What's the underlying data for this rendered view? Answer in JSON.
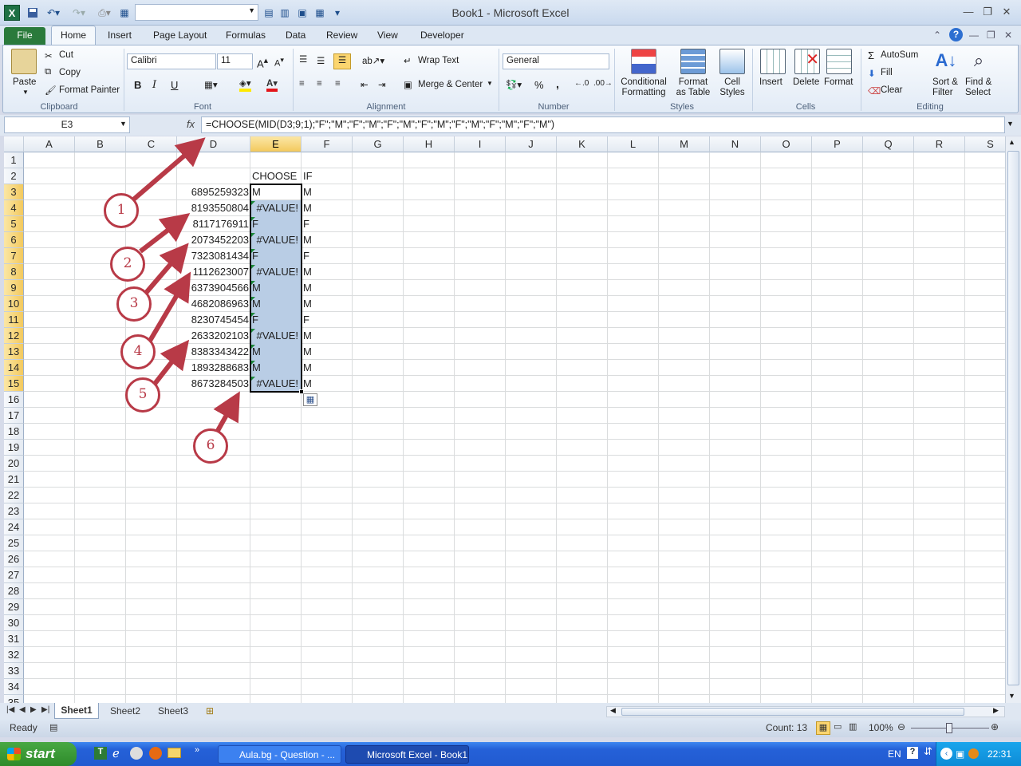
{
  "window": {
    "title": "Book1  -  Microsoft Excel"
  },
  "ribbon_tabs": [
    "File",
    "Home",
    "Insert",
    "Page Layout",
    "Formulas",
    "Data",
    "Review",
    "View",
    "Developer"
  ],
  "clipboard": {
    "paste": "Paste",
    "cut": "Cut",
    "copy": "Copy",
    "format_painter": "Format Painter",
    "label": "Clipboard"
  },
  "font": {
    "name": "Calibri",
    "size": "11",
    "bold": "B",
    "italic": "I",
    "underline": "U",
    "label": "Font"
  },
  "alignment": {
    "wrap": "Wrap Text",
    "merge": "Merge & Center",
    "label": "Alignment"
  },
  "number": {
    "format": "General",
    "percent": "%",
    "comma": ",",
    "label": "Number"
  },
  "styles": {
    "conditional": [
      "Conditional",
      "Formatting"
    ],
    "format_table": [
      "Format",
      "as Table"
    ],
    "cell_styles": [
      "Cell",
      "Styles"
    ],
    "label": "Styles"
  },
  "cells": {
    "insert": "Insert",
    "delete": "Delete",
    "format": "Format",
    "label": "Cells"
  },
  "editing": {
    "autosum": "AutoSum",
    "fill": "Fill",
    "clear": "Clear",
    "sort": [
      "Sort &",
      "Filter"
    ],
    "find": [
      "Find &",
      "Select"
    ],
    "label": "Editing"
  },
  "formula_bar": {
    "name_box": "E3",
    "fx": "fx",
    "formula": "=CHOOSE(MID(D3;9;1);\"F\";\"M\";\"F\";\"M\";\"F\";\"M\";\"F\";\"M\";\"F\";\"M\";\"F\";\"M\";\"F\";\"M\")"
  },
  "columns": [
    "A",
    "B",
    "C",
    "D",
    "E",
    "F",
    "G",
    "H",
    "I",
    "J",
    "K",
    "L",
    "M",
    "N",
    "O",
    "P",
    "Q",
    "R",
    "S"
  ],
  "rows": [
    "1",
    "2",
    "3",
    "4",
    "5",
    "6",
    "7",
    "8",
    "9",
    "10",
    "11",
    "12",
    "13",
    "14",
    "15",
    "16",
    "17",
    "18",
    "19",
    "20",
    "21",
    "22",
    "23",
    "24",
    "25",
    "26",
    "27",
    "28",
    "29",
    "30",
    "31",
    "32",
    "33",
    "34",
    "35"
  ],
  "headers": {
    "e2": "CHOOSE",
    "f2": "IF"
  },
  "data_rows": [
    {
      "d": "6895259323",
      "e": "M",
      "f": "M"
    },
    {
      "d": "8193550804",
      "e": "#VALUE!",
      "f": "M"
    },
    {
      "d": "8117176911",
      "e": "F",
      "f": "F"
    },
    {
      "d": "2073452203",
      "e": "#VALUE!",
      "f": "M"
    },
    {
      "d": "7323081434",
      "e": "F",
      "f": "F"
    },
    {
      "d": "1112623007",
      "e": "#VALUE!",
      "f": "M"
    },
    {
      "d": "6373904566",
      "e": "M",
      "f": "M"
    },
    {
      "d": "4682086963",
      "e": "M",
      "f": "M"
    },
    {
      "d": "8230745454",
      "e": "F",
      "f": "F"
    },
    {
      "d": "2633202103",
      "e": "#VALUE!",
      "f": "M"
    },
    {
      "d": "8383343422",
      "e": "M",
      "f": "M"
    },
    {
      "d": "1893288683",
      "e": "M",
      "f": "M"
    },
    {
      "d": "8673284503",
      "e": "#VALUE!",
      "f": "M"
    }
  ],
  "callouts": [
    "1",
    "2",
    "3",
    "4",
    "5",
    "6"
  ],
  "sheets": [
    "Sheet1",
    "Sheet2",
    "Sheet3"
  ],
  "status": {
    "ready": "Ready",
    "count": "Count: 13",
    "zoom": "100%"
  },
  "taskbar": {
    "start": "start",
    "tasks": [
      "Aula.bg - Question - ...",
      "Microsoft Excel - Book1"
    ],
    "lang": "EN",
    "clock": "22:31"
  },
  "colors": {
    "accent_green": "#2a7a3b",
    "selection": "#b9cde5",
    "callout": "#b83a47"
  }
}
